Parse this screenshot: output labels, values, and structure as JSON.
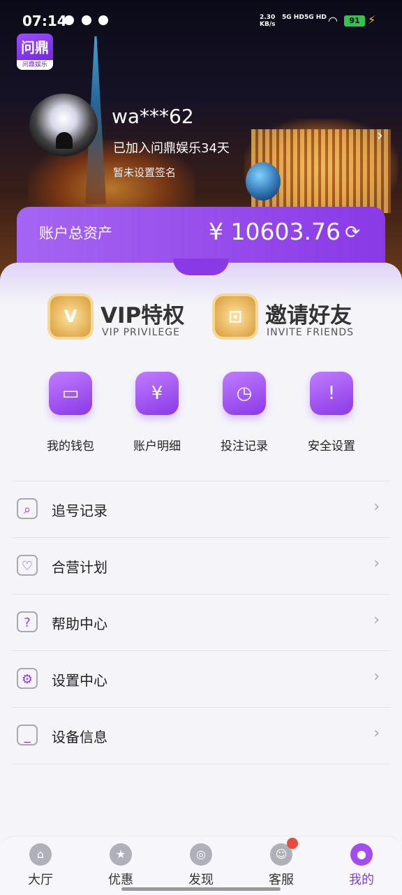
{
  "status": {
    "time": "07:14",
    "network_speed": "2.30",
    "network_unit": "KB/s",
    "sig1": "5G HD",
    "sig2": "5G HD",
    "battery": "91"
  },
  "app": {
    "logo_text": "问鼎",
    "logo_sub": "问鼎娱乐"
  },
  "profile": {
    "username": "wa***62",
    "joined": "已加入问鼎娱乐34天",
    "signature": "暂未设置签名"
  },
  "asset": {
    "label": "账户总资产",
    "amount": "¥ 10603.76"
  },
  "promos": [
    {
      "title": "VIP特权",
      "subtitle": "VIP PRIVILEGE",
      "icon": "vip-badge-icon"
    },
    {
      "title": "邀请好友",
      "subtitle": "INVITE FRIENDS",
      "icon": "invite-badge-icon"
    }
  ],
  "quick_actions": [
    {
      "label": "我的钱包",
      "icon": "wallet-icon"
    },
    {
      "label": "账户明细",
      "icon": "statement-icon"
    },
    {
      "label": "投注记录",
      "icon": "bet-record-icon"
    },
    {
      "label": "安全设置",
      "icon": "security-shield-icon"
    }
  ],
  "menu": [
    {
      "label": "追号记录",
      "icon": "search-record-icon"
    },
    {
      "label": "合营计划",
      "icon": "partner-heart-icon"
    },
    {
      "label": "帮助中心",
      "icon": "help-icon"
    },
    {
      "label": "设置中心",
      "icon": "settings-gear-icon"
    },
    {
      "label": "设备信息",
      "icon": "device-icon"
    }
  ],
  "tabs": [
    {
      "label": "大厅",
      "icon": "home-icon"
    },
    {
      "label": "优惠",
      "icon": "promo-star-icon"
    },
    {
      "label": "发现",
      "icon": "compass-icon"
    },
    {
      "label": "客服",
      "icon": "support-icon"
    },
    {
      "label": "我的",
      "icon": "profile-icon"
    }
  ],
  "accent_color": "#8a39e6"
}
